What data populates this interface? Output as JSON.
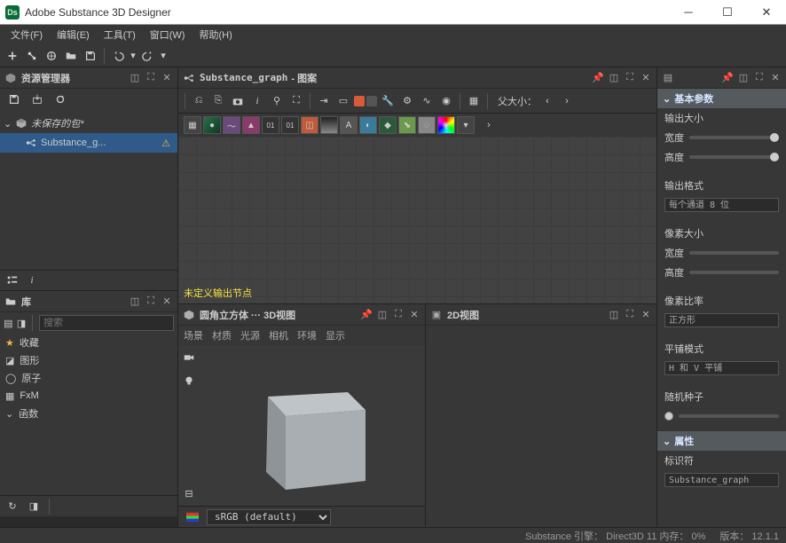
{
  "window": {
    "title": "Adobe Substance 3D Designer",
    "logo": "Ds"
  },
  "menu": {
    "file": "文件(F)",
    "edit": "编辑(E)",
    "tools": "工具(T)",
    "window": "窗口(W)",
    "help": "帮助(H)"
  },
  "explorer": {
    "title": "资源管理器",
    "pkg": "未保存的包*",
    "graph": "Substance_g..."
  },
  "tabs": {
    "explorer_left": "i"
  },
  "library": {
    "title": "库",
    "search_ph": "搜索",
    "fav": "收藏",
    "shapes": "图形",
    "atomic": "原子",
    "fxm": "FxM",
    "fn": "函数"
  },
  "graph": {
    "tab": "Substance_graph",
    "suffix": " - 图案",
    "parent": "父大小：",
    "warn": "未定义输出节点"
  },
  "view3d": {
    "title": "圆角立方体 ···  3D视图",
    "scene": "场景",
    "material": "材质",
    "light": "光源",
    "camera": "相机",
    "env": "环境",
    "display": "显示",
    "cs": "sRGB (default)"
  },
  "view2d": {
    "title": "2D视图"
  },
  "props": {
    "base": "基本参数",
    "outsize": "输出大小",
    "width": "宽度",
    "height": "高度",
    "outformat": "输出格式",
    "fmt_val": "每个通道 8 位",
    "pixsize": "像素大小",
    "pixratio": "像素比率",
    "ratio_val": "正方形",
    "tiling": "平铺模式",
    "tiling_val": "H 和 V 平铺",
    "seed": "随机种子",
    "attrs": "属性",
    "ident": "标识符",
    "ident_val": "Substance_graph"
  },
  "status": {
    "engine": "Substance 引擎：  Direct3D 11 内存：  0%",
    "ver": "版本： 12.1.1"
  }
}
